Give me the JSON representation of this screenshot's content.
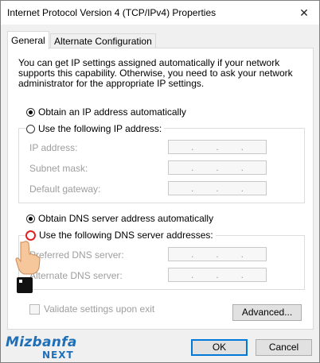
{
  "window": {
    "title": "Internet Protocol Version 4 (TCP/IPv4) Properties",
    "close_symbol": "✕"
  },
  "tabs": [
    {
      "label": "General",
      "active": true
    },
    {
      "label": "Alternate Configuration",
      "active": false
    }
  ],
  "description": "You can get IP settings assigned automatically if your network supports this capability. Otherwise, you need to ask your network administrator for the appropriate IP settings.",
  "ip": {
    "auto_label": "Obtain an IP address automatically",
    "auto_selected": true,
    "manual_label": "Use the following IP address:",
    "fields": [
      {
        "label": "IP address:",
        "value": ".       .       ."
      },
      {
        "label": "Subnet mask:",
        "value": ".       .       ."
      },
      {
        "label": "Default gateway:",
        "value": ".       .       ."
      }
    ]
  },
  "dns": {
    "auto_label": "Obtain DNS server address automatically",
    "auto_selected": true,
    "manual_label": "Use the following DNS server addresses:",
    "fields": [
      {
        "label": "Preferred DNS server:",
        "value": ".       .       ."
      },
      {
        "label": "Alternate DNS server:",
        "value": ".       .       ."
      }
    ]
  },
  "validate_label": "Validate settings upon exit",
  "buttons": {
    "advanced": "Advanced...",
    "ok": "OK",
    "cancel": "Cancel"
  },
  "watermark": {
    "main": "Mizbanfa",
    "sub": "NEXT"
  },
  "colors": {
    "highlight_red": "#e32020",
    "accent_blue": "#0078d7",
    "brand_blue": "#1f6fb8"
  }
}
